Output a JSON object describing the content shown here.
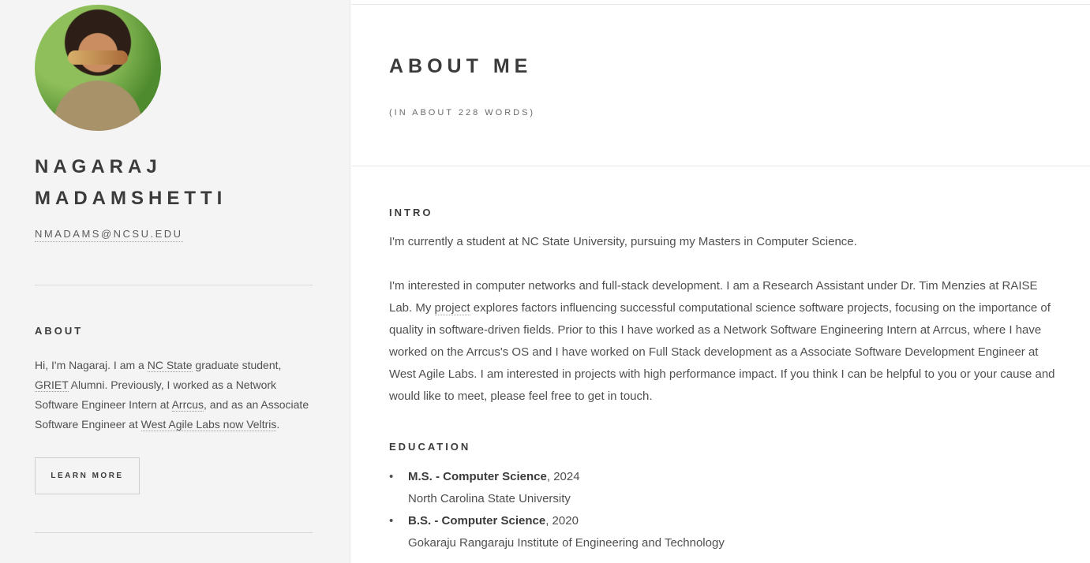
{
  "sidebar": {
    "name": "NAGARAJ MADAMSHETTI",
    "email": "NMADAMS@NCSU.EDU",
    "about_heading": "ABOUT",
    "about": {
      "t1": "Hi, I'm Nagaraj. I am a ",
      "l1": "NC State",
      "t2": " graduate student, ",
      "l2": "GRIET",
      "t3": " Alumni. Previously, I worked as a Network Software Engineer Intern at ",
      "l3": "Arrcus",
      "t4": ", and as an Associate Software Engineer at ",
      "l4": "West Agile Labs now Veltris",
      "t5": "."
    },
    "learn_more": "LEARN MORE"
  },
  "main": {
    "title": "ABOUT ME",
    "subtitle": "(IN ABOUT 228 WORDS)",
    "intro_heading": "INTRO",
    "intro_p1": "I'm currently a student at NC State University, pursuing my Masters in Computer Science.",
    "intro_p2": {
      "t1": "I'm interested in computer networks and full-stack development. I am a Research Assistant under Dr. Tim Menzies at RAISE Lab. My ",
      "link": "project",
      "t2": " explores factors influencing successful computational science software projects, focusing on the importance of quality in software-driven fields. Prior to this I have worked as a Network Software Engineering Intern at Arrcus, where I have worked on the Arrcus's OS and I have worked on Full Stack development as a Associate Software Development Engineer at West Agile Labs. I am interested in projects with high performance impact. If you think I can be helpful to you or your cause and would like to meet, please feel free to get in touch."
    },
    "education_heading": "EDUCATION",
    "education": [
      {
        "degree": "M.S. - Computer Science",
        "year": ", 2024",
        "school": "North Carolina State University"
      },
      {
        "degree": "B.S. - Computer Science",
        "year": ", 2020",
        "school": "Gokaraju Rangaraju Institute of Engineering and Technology"
      }
    ],
    "bullet": "•"
  }
}
